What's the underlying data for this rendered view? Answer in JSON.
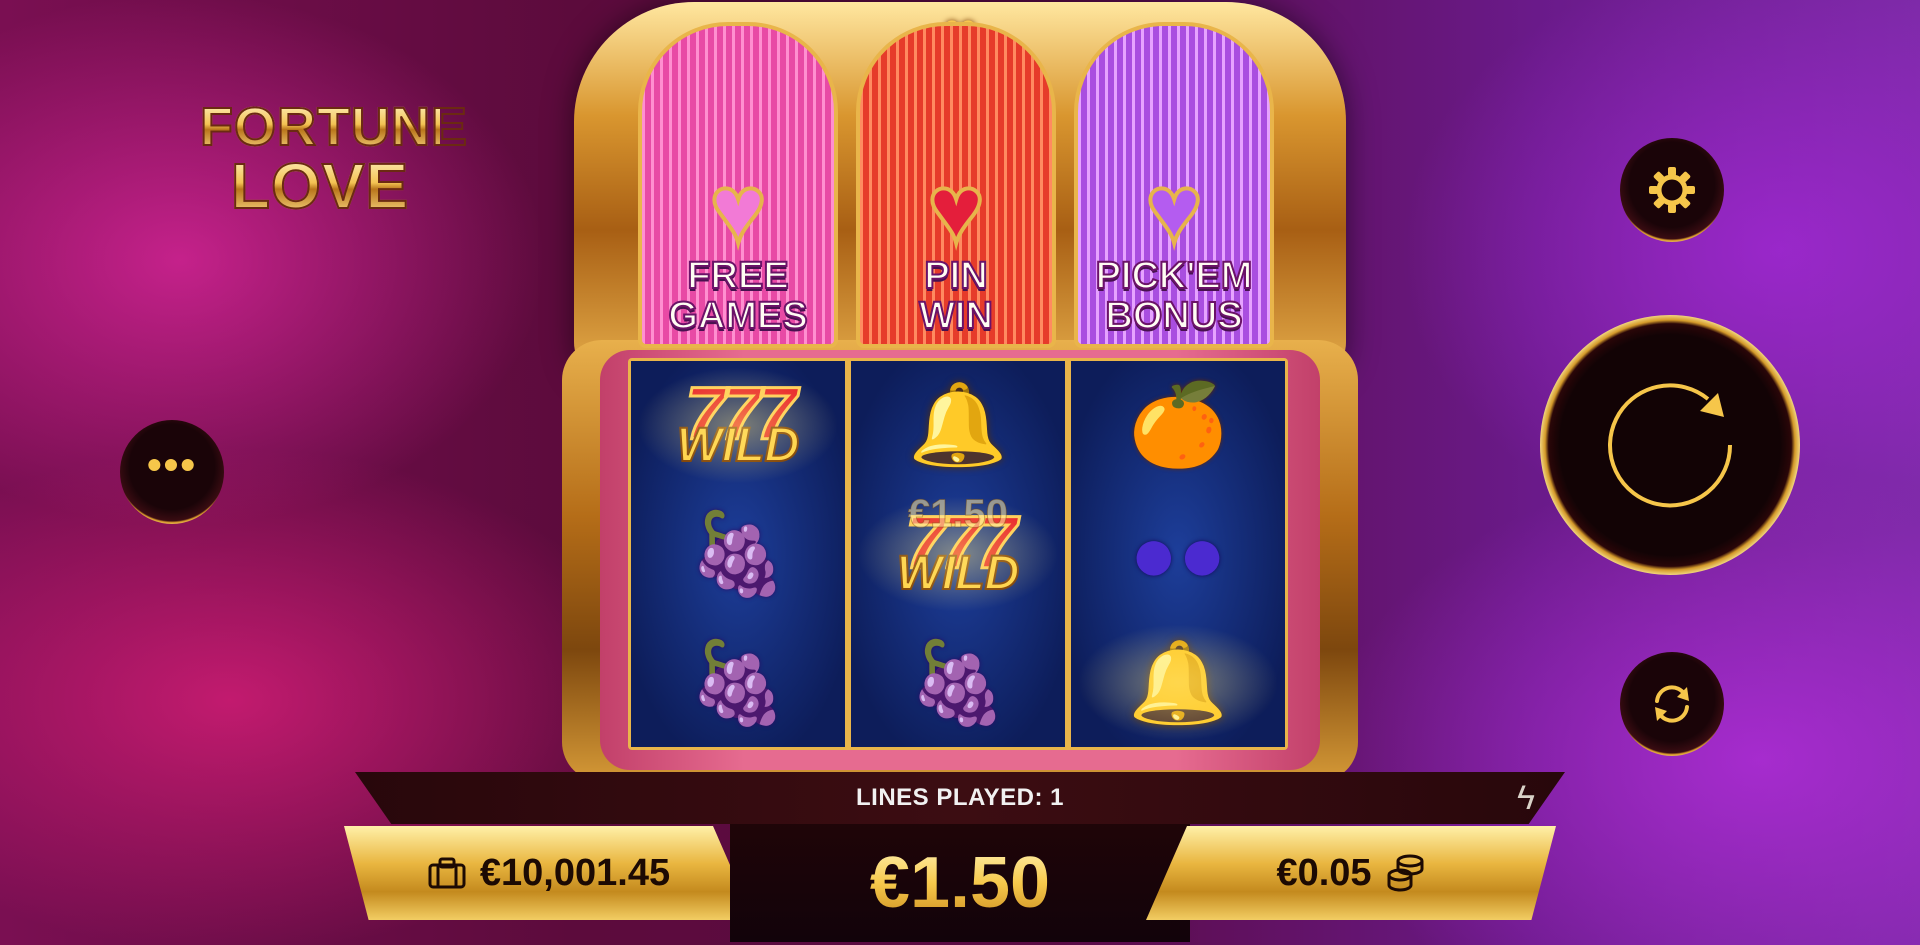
{
  "game": {
    "logo_line1": "FORTUNE",
    "logo_line2": "LOVE"
  },
  "bonus_panels": [
    {
      "label_line1": "FREE",
      "label_line2": "GAMES",
      "gem_color": "#f27ad6"
    },
    {
      "label_line1": "PIN",
      "label_line2": "WIN",
      "gem_color": "#e41e3b"
    },
    {
      "label_line1": "PICK'EM",
      "label_line2": "BONUS",
      "gem_color": "#b45cf0"
    }
  ],
  "reels": [
    [
      "seven-wild",
      "grapes",
      "grapes"
    ],
    [
      "bells",
      "seven-wild",
      "grapes"
    ],
    [
      "oranges",
      "plums",
      "bells"
    ]
  ],
  "wild_label": "WILD",
  "win_overlay": "€1.50",
  "status": {
    "lines_played": "LINES PLAYED: 1"
  },
  "balance": "€10,001.45",
  "bet": "€1.50",
  "coin_value": "€0.05",
  "icons": {
    "menu": "more-dots-icon",
    "settings": "gear-icon",
    "spin": "spin-icon",
    "autoplay": "autoplay-icon",
    "turbo": "lightning-bolt-icon",
    "balance": "briefcase-icon",
    "coins": "coin-stack-icon"
  },
  "colors": {
    "gold": "#e9b54a",
    "reel_bg": "#0d1d5a",
    "bet_text": "#f7c94c"
  }
}
